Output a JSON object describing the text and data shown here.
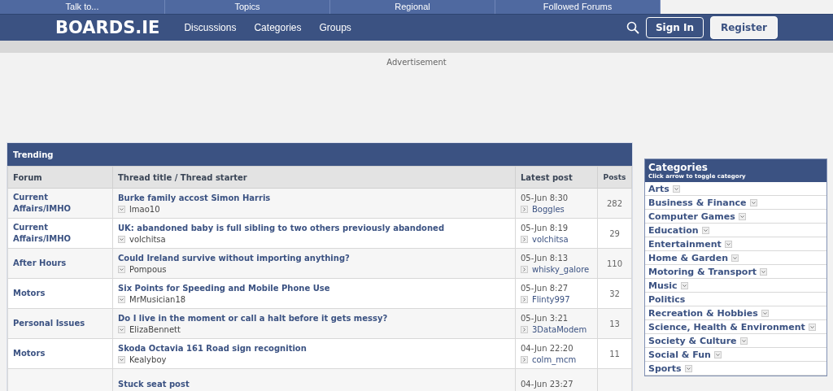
{
  "top_links": [
    "Talk to...",
    "Topics",
    "Regional",
    "Followed Forums"
  ],
  "header": {
    "logo": "BOARDS.IE",
    "nav": [
      "Discussions",
      "Categories",
      "Groups"
    ],
    "sign_in": "Sign In",
    "register": "Register"
  },
  "advertisement": "Advertisement",
  "trending": {
    "title": "Trending",
    "columns": [
      "Forum",
      "Thread title / Thread starter",
      "Latest post",
      "Posts"
    ],
    "rows": [
      {
        "forum": "Current Affairs/IMHO",
        "title": "Burke family accost Simon Harris",
        "starter": "lmao10",
        "latest_time": "05-Jun 8:30",
        "latest_user": "Boggles",
        "posts": "282"
      },
      {
        "forum": "Current Affairs/IMHO",
        "title": "UK: abandoned baby is full sibling to two others previously abandoned",
        "starter": "volchitsa",
        "latest_time": "05-Jun 8:19",
        "latest_user": "volchitsa",
        "posts": "29"
      },
      {
        "forum": "After Hours",
        "title": "Could Ireland survive without importing anything?",
        "starter": "Pompous",
        "latest_time": "05-Jun 8:13",
        "latest_user": "whisky_galore",
        "posts": "110"
      },
      {
        "forum": "Motors",
        "title": "Six Points for Speeding and Mobile Phone Use",
        "starter": "MrMusician18",
        "latest_time": "05-Jun 8:27",
        "latest_user": "Flinty997",
        "posts": "32"
      },
      {
        "forum": "Personal Issues",
        "title": "Do I live in the moment or call a halt before it gets messy?",
        "starter": "ElizaBennett",
        "latest_time": "05-Jun 3:21",
        "latest_user": "3DataModem",
        "posts": "13"
      },
      {
        "forum": "Motors",
        "title": "Skoda Octavia 161 Road sign recognition",
        "starter": "Kealyboy",
        "latest_time": "04-Jun 22:20",
        "latest_user": "colm_mcm",
        "posts": "11"
      },
      {
        "title": "Stuck seat post",
        "latest_time": "04-Jun 23:27"
      }
    ]
  },
  "categories": {
    "title": "Categories",
    "subtitle": "Click arrow to toggle category",
    "items": [
      {
        "label": "Arts",
        "toggle": true
      },
      {
        "label": "Business & Finance",
        "toggle": true
      },
      {
        "label": "Computer Games",
        "toggle": true
      },
      {
        "label": "Education",
        "toggle": true
      },
      {
        "label": "Entertainment",
        "toggle": true
      },
      {
        "label": "Home & Garden",
        "toggle": true
      },
      {
        "label": "Motoring & Transport",
        "toggle": true
      },
      {
        "label": "Music",
        "toggle": true
      },
      {
        "label": "Politics",
        "toggle": false
      },
      {
        "label": "Recreation & Hobbies",
        "toggle": true
      },
      {
        "label": "Science, Health & Environment",
        "toggle": true
      },
      {
        "label": "Society & Culture",
        "toggle": true
      },
      {
        "label": "Social & Fun",
        "toggle": true
      },
      {
        "label": "Sports",
        "toggle": true
      }
    ]
  }
}
